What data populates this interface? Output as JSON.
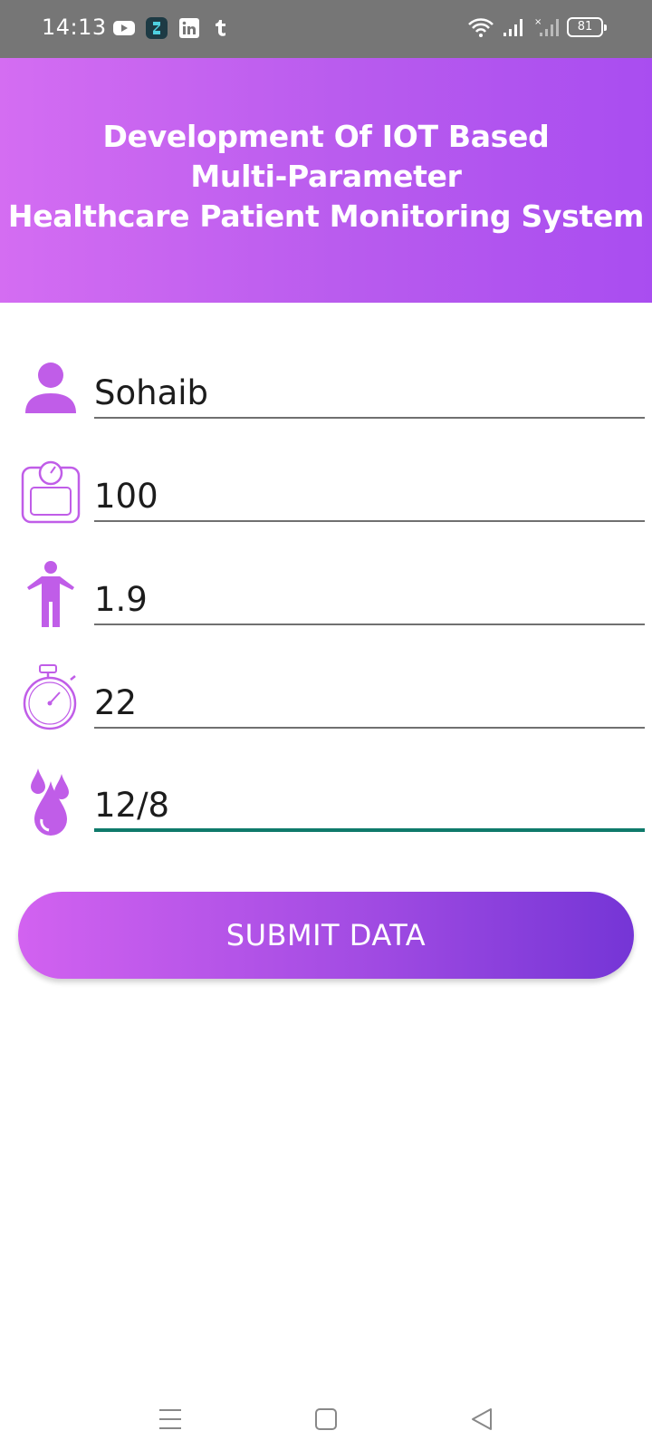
{
  "status_bar": {
    "time": "14:13",
    "notification_icons": [
      "youtube-icon",
      "app-icon",
      "linkedin-icon",
      "tumblr-icon"
    ],
    "battery_level": "81",
    "signal_icons": [
      "wifi-icon",
      "signal-icon",
      "no-signal-icon"
    ]
  },
  "header": {
    "title": "Development Of IOT Based\nMulti-Parameter\nHealthcare Patient Monitoring System",
    "gradient_colors": [
      "#d46df2",
      "#a94df0"
    ]
  },
  "form": {
    "fields": [
      {
        "icon": "person-icon",
        "value": "Sohaib"
      },
      {
        "icon": "weight-scale-icon",
        "value": "100"
      },
      {
        "icon": "height-icon",
        "value": "1.9"
      },
      {
        "icon": "stopwatch-icon",
        "value": "22"
      },
      {
        "icon": "blood-drops-icon",
        "value": "12/8"
      }
    ],
    "accent_color": "#c05de8",
    "focused_underline_color": "#0f7a6b"
  },
  "submit": {
    "label": "SUBMIT DATA"
  },
  "nav_bar": {
    "buttons": [
      "menu-icon",
      "home-icon",
      "back-icon"
    ]
  }
}
